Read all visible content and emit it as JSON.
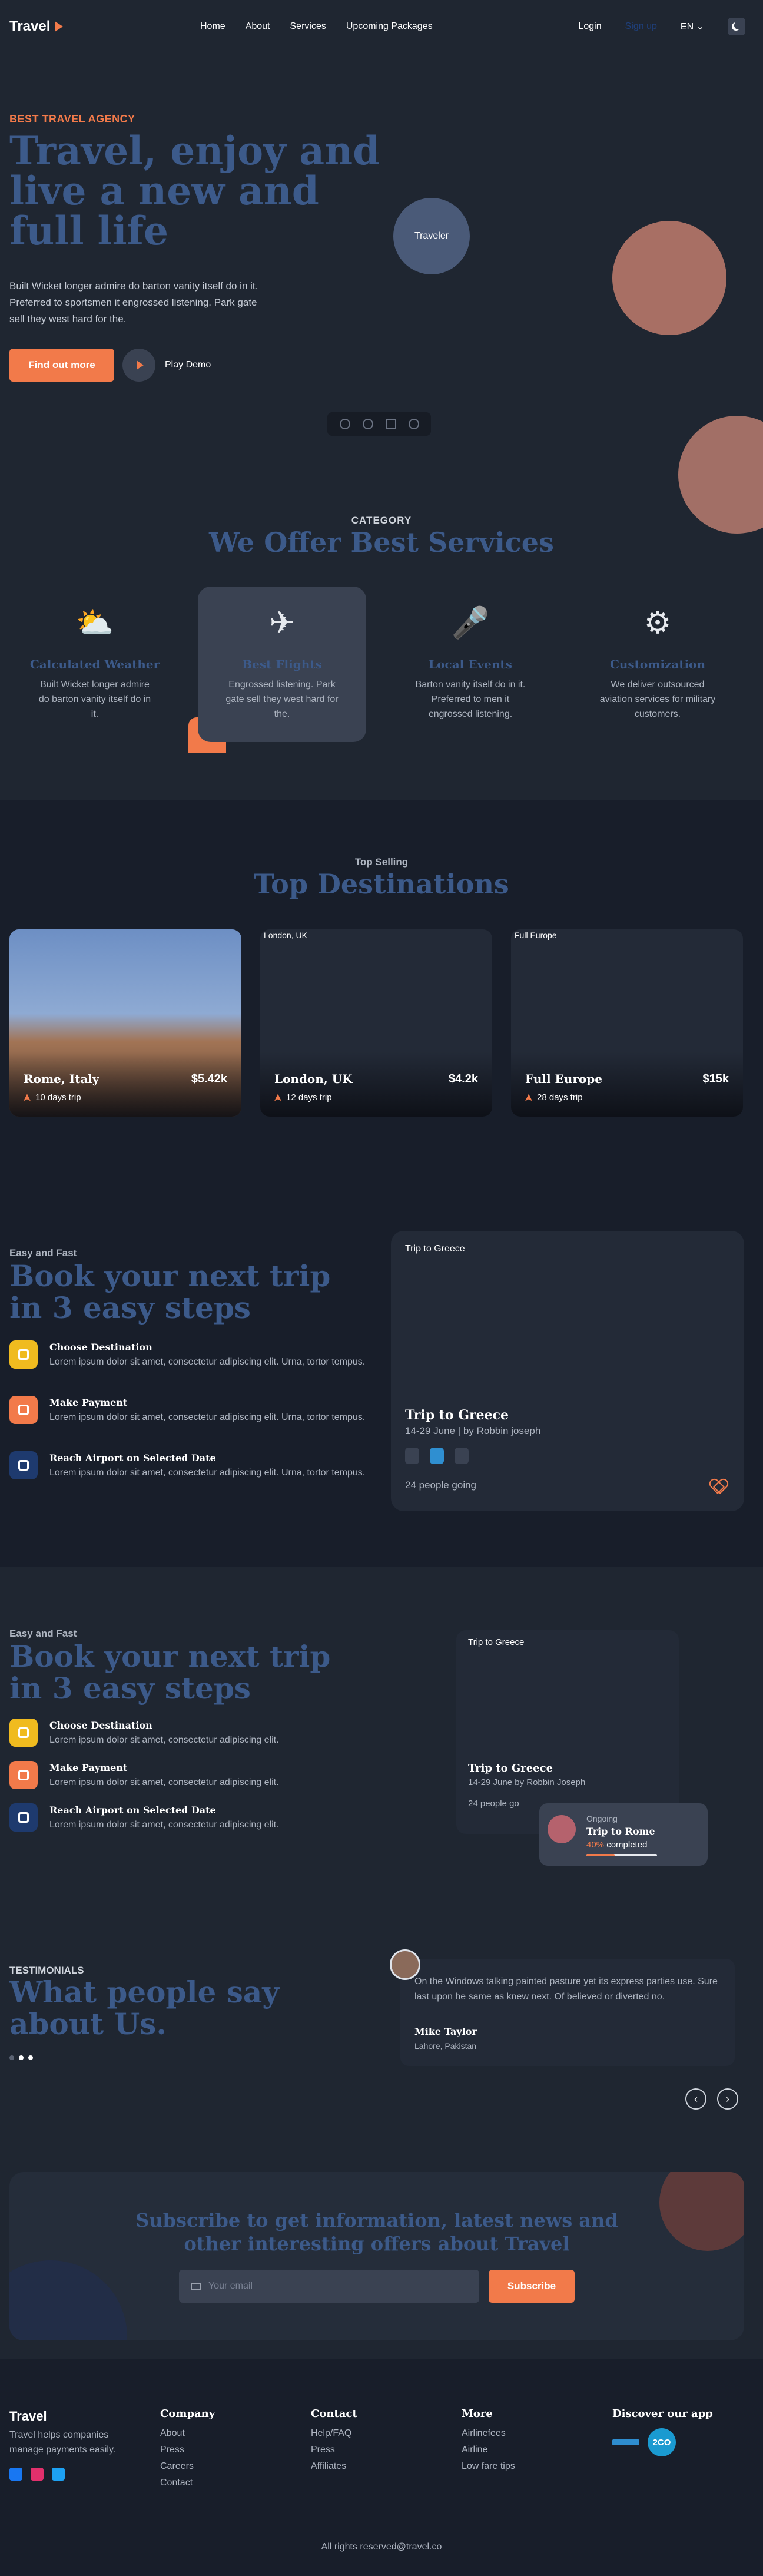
{
  "nav": {
    "brand": "Travel",
    "links": [
      "Home",
      "About",
      "Services",
      "Upcoming Packages"
    ],
    "login": "Login",
    "signup": "Sign up",
    "language": "EN"
  },
  "hero": {
    "eyebrow": "BEST TRAVEL AGENCY",
    "title": "Travel, enjoy and live a new and full life",
    "description": "Built Wicket longer admire do barton vanity itself do in it. Preferred to sportsmen it engrossed listening. Park gate sell they west hard for the.",
    "cta_label": "Find out more",
    "play_label": "Play Demo",
    "image_alt": "Traveler"
  },
  "services": {
    "eyebrow": "CATEGORY",
    "title": "We Offer Best Services",
    "items": [
      {
        "name": "Calculated Weather",
        "desc": "Built Wicket longer admire do barton vanity itself do in it.",
        "icon": "weather-icon"
      },
      {
        "name": "Best Flights",
        "desc": "Engrossed listening. Park gate sell they west hard for the.",
        "icon": "airplane-icon"
      },
      {
        "name": "Local Events",
        "desc": "Barton vanity itself do in it. Preferred to men it engrossed listening.",
        "icon": "microphone-icon"
      },
      {
        "name": "Customization",
        "desc": "We deliver outsourced aviation services for military customers.",
        "icon": "settings-icon"
      }
    ]
  },
  "destinations": {
    "eyebrow": "Top Selling",
    "title": "Top Destinations",
    "items": [
      {
        "name": "Rome, Italy",
        "price": "$5.42k",
        "trip": "10 days trip",
        "image_alt": ""
      },
      {
        "name": "London, UK",
        "price": "$4.2k",
        "trip": "12 days trip",
        "image_alt": "London, UK"
      },
      {
        "name": "Full Europe",
        "price": "$15k",
        "trip": "28 days trip",
        "image_alt": "Full Europe"
      }
    ]
  },
  "steps1": {
    "eyebrow": "Easy and Fast",
    "title": "Book your next trip in 3 easy steps",
    "items": [
      {
        "name": "Choose Destination",
        "desc": "Lorem ipsum dolor sit amet, consectetur adipiscing elit. Urna, tortor tempus.",
        "color": "#f0bb1f"
      },
      {
        "name": "Make Payment",
        "desc": "Lorem ipsum dolor sit amet, consectetur adipiscing elit. Urna, tortor tempus.",
        "color": "#f27a4a"
      },
      {
        "name": "Reach Airport on Selected Date",
        "desc": "Lorem ipsum dolor sit amet, consectetur adipiscing elit. Urna, tortor tempus.",
        "color": "#1e3a6e"
      }
    ],
    "card": {
      "image_alt": "Trip to Greece",
      "title": "Trip to Greece",
      "subtitle": "14-29 June | by Robbin joseph",
      "going": "24 people going"
    }
  },
  "steps2": {
    "eyebrow": "Easy and Fast",
    "title": "Book your next trip in 3 easy steps",
    "items": [
      {
        "name": "Choose Destination",
        "desc": "Lorem ipsum dolor sit amet, consectetur adipiscing elit.",
        "color": "#f0bb1f"
      },
      {
        "name": "Make Payment",
        "desc": "Lorem ipsum dolor sit amet, consectetur adipiscing elit.",
        "color": "#f27a4a"
      },
      {
        "name": "Reach Airport on Selected Date",
        "desc": "Lorem ipsum dolor sit amet, consectetur adipiscing elit.",
        "color": "#1e3a6e"
      }
    ],
    "card": {
      "image_alt": "Trip to Greece",
      "title": "Trip to Greece",
      "subtitle": "14-29 June by Robbin Joseph",
      "going": "24 people go"
    },
    "ongoing": {
      "label": "Ongoing",
      "title": "Trip to Rome",
      "percent": "40%",
      "completed": "completed",
      "progress": 0.4
    }
  },
  "testimonials": {
    "eyebrow": "TESTIMONIALS",
    "title": "What people say about Us.",
    "quote": "On the Windows talking painted pasture yet its express parties use. Sure last upon he same as knew next. Of believed or diverted no.",
    "name": "Mike Taylor",
    "place": "Lahore, Pakistan",
    "prev": "‹",
    "next": "›"
  },
  "subscribe": {
    "title": "Subscribe to get information, latest news and other interesting offers about Travel",
    "placeholder": "Your email",
    "button": "Subscribe"
  },
  "footer": {
    "brand": "Travel",
    "desc": "Travel helps companies manage payments easily.",
    "columns": [
      {
        "title": "Company",
        "links": [
          "About",
          "Press",
          "Careers",
          "Contact"
        ]
      },
      {
        "title": "Contact",
        "links": [
          "Help/FAQ",
          "Press",
          "Affiliates"
        ]
      },
      {
        "title": "More",
        "links": [
          "Airlinefees",
          "Airline",
          "Low fare tips"
        ]
      }
    ],
    "apps_title": "Discover our app",
    "app_badge": "2CO",
    "copyright": "All rights reserved@travel.co"
  },
  "colors": {
    "accent": "#f27a4a",
    "title_blue": "#3c5a8a",
    "background": "#1f2631"
  }
}
